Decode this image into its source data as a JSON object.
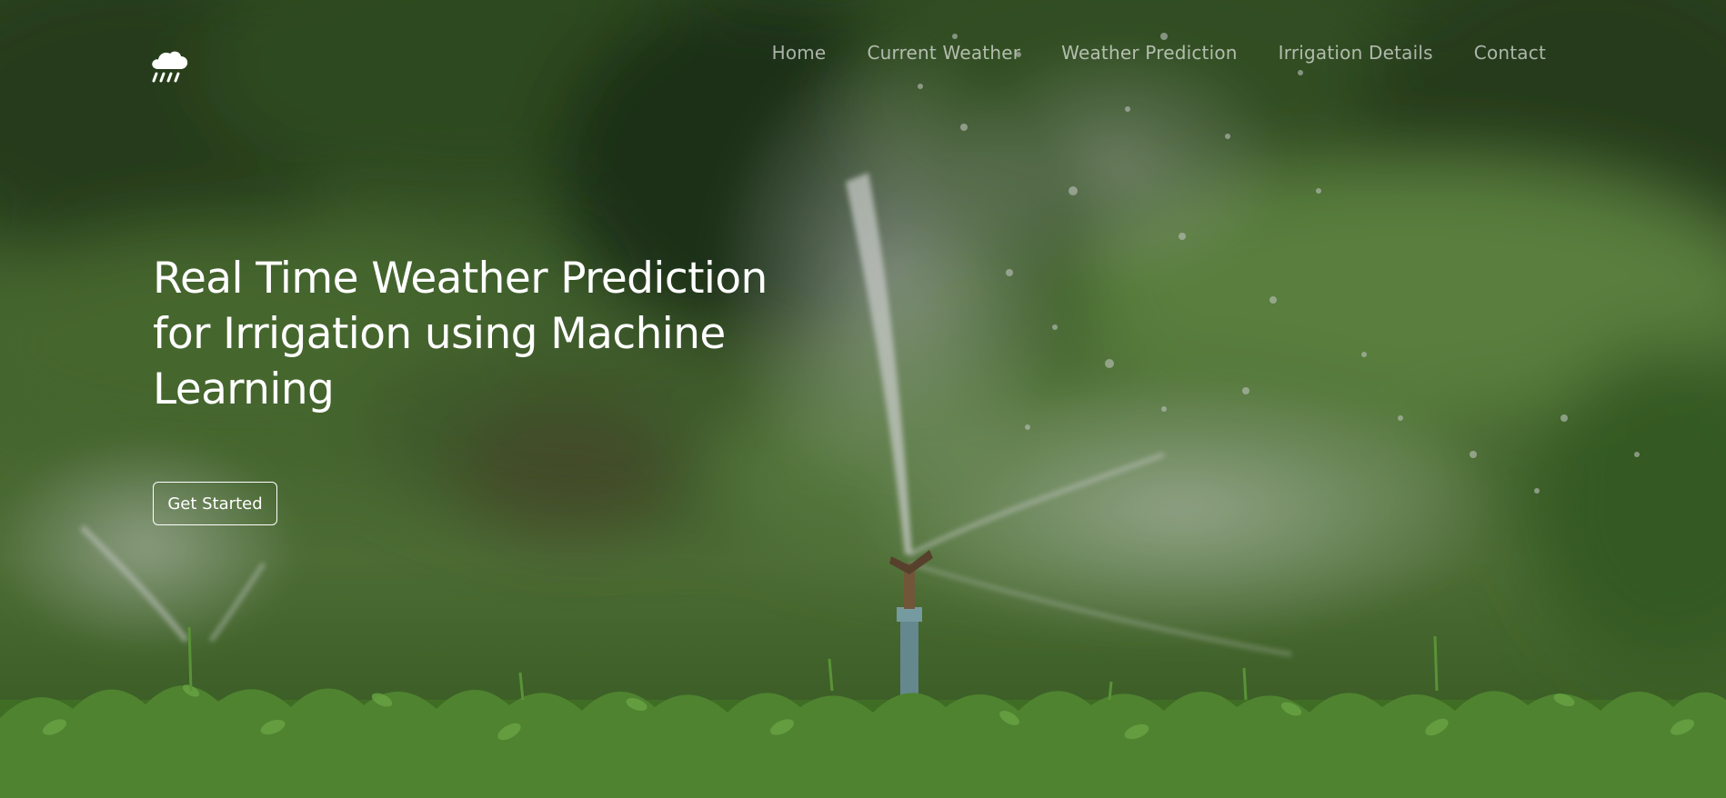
{
  "nav": {
    "logo_icon": "cloud-rain-icon",
    "items": [
      {
        "label": "Home"
      },
      {
        "label": "Current Weather"
      },
      {
        "label": "Weather Prediction"
      },
      {
        "label": "Irrigation Details"
      },
      {
        "label": "Contact"
      }
    ]
  },
  "hero": {
    "title": "Real Time Weather Prediction for Irrigation using Machine Learning",
    "cta_label": "Get Started",
    "background": "irrigation-sprinkler-field-photo"
  },
  "colors": {
    "text": "#ffffff",
    "nav_text": "#c8cfc4",
    "foliage": "#4c7a34",
    "overlay": "#000000"
  }
}
